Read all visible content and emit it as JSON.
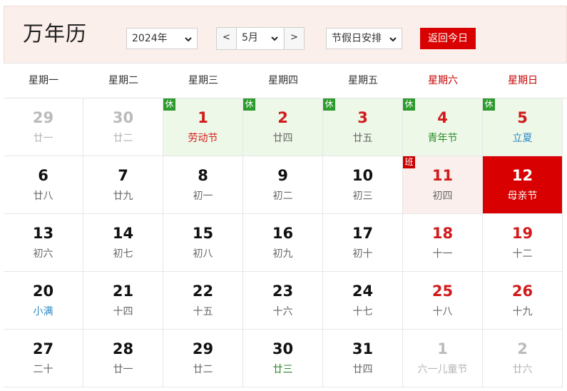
{
  "header": {
    "title": "万年历",
    "year_select": "2024年",
    "prev_label": "<",
    "month_select": "5月",
    "next_label": ">",
    "holiday_select": "节假日安排",
    "today_button": "返回今日"
  },
  "weekdays": [
    "星期一",
    "星期二",
    "星期三",
    "星期四",
    "星期五",
    "星期六",
    "星期日"
  ],
  "colors": {
    "accent_red": "#d80000",
    "holiday_bg": "#eef8e8",
    "workday_bg": "#faefec",
    "header_bg": "#fbefeb",
    "rest_badge": "#2c9a2c"
  },
  "days": [
    {
      "num": "29",
      "sub": "廿一",
      "state": "other"
    },
    {
      "num": "30",
      "sub": "廿二",
      "state": "other"
    },
    {
      "num": "1",
      "sub": "劳动节",
      "state": "holiday",
      "badge": "休",
      "numColor": "red",
      "subColor": "red"
    },
    {
      "num": "2",
      "sub": "廿四",
      "state": "holiday",
      "badge": "休",
      "numColor": "red"
    },
    {
      "num": "3",
      "sub": "廿五",
      "state": "holiday",
      "badge": "休",
      "numColor": "red"
    },
    {
      "num": "4",
      "sub": "青年节",
      "state": "holiday",
      "badge": "休",
      "numColor": "red",
      "subColor": "green"
    },
    {
      "num": "5",
      "sub": "立夏",
      "state": "holiday",
      "badge": "休",
      "numColor": "red",
      "subColor": "blue"
    },
    {
      "num": "6",
      "sub": "廿八"
    },
    {
      "num": "7",
      "sub": "廿九"
    },
    {
      "num": "8",
      "sub": "初一"
    },
    {
      "num": "9",
      "sub": "初二"
    },
    {
      "num": "10",
      "sub": "初三"
    },
    {
      "num": "11",
      "sub": "初四",
      "state": "workday",
      "badge": "班",
      "badgeType": "work",
      "numColor": "red"
    },
    {
      "num": "12",
      "sub": "母亲节",
      "state": "today"
    },
    {
      "num": "13",
      "sub": "初六"
    },
    {
      "num": "14",
      "sub": "初七"
    },
    {
      "num": "15",
      "sub": "初八"
    },
    {
      "num": "16",
      "sub": "初九"
    },
    {
      "num": "17",
      "sub": "初十"
    },
    {
      "num": "18",
      "sub": "十一",
      "numColor": "red"
    },
    {
      "num": "19",
      "sub": "十二",
      "numColor": "red"
    },
    {
      "num": "20",
      "sub": "小满",
      "subColor": "blue"
    },
    {
      "num": "21",
      "sub": "十四"
    },
    {
      "num": "22",
      "sub": "十五"
    },
    {
      "num": "23",
      "sub": "十六"
    },
    {
      "num": "24",
      "sub": "十七"
    },
    {
      "num": "25",
      "sub": "十八",
      "numColor": "red"
    },
    {
      "num": "26",
      "sub": "十九",
      "numColor": "red"
    },
    {
      "num": "27",
      "sub": "二十"
    },
    {
      "num": "28",
      "sub": "廿一"
    },
    {
      "num": "29",
      "sub": "廿二"
    },
    {
      "num": "30",
      "sub": "廿三",
      "subColor": "green"
    },
    {
      "num": "31",
      "sub": "廿四"
    },
    {
      "num": "1",
      "sub": "六一儿童节",
      "state": "other"
    },
    {
      "num": "2",
      "sub": "廿六",
      "state": "other"
    }
  ]
}
